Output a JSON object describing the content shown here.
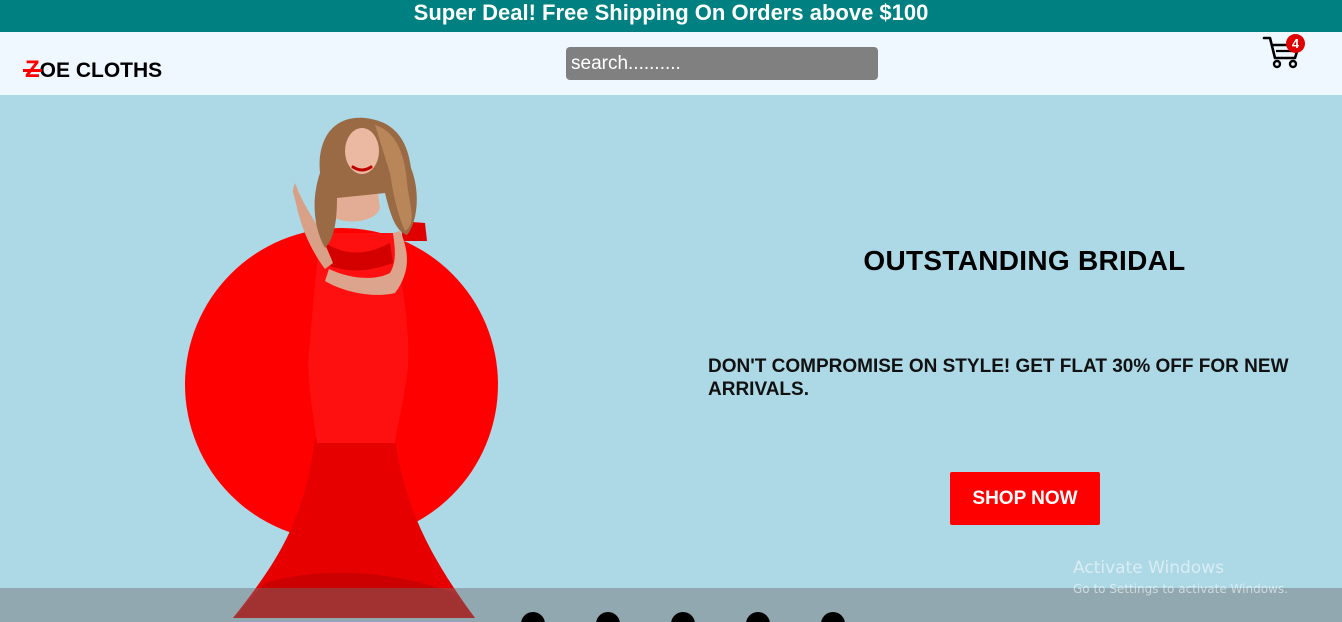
{
  "promo": {
    "text": "Super Deal! Free Shipping On Orders above $100"
  },
  "header": {
    "logo": {
      "first_letter": "Z",
      "rest": "OE CLOTHS"
    },
    "search": {
      "placeholder": "search.........."
    },
    "cart": {
      "icon": "cart-icon",
      "count": "4"
    }
  },
  "hero": {
    "title": "OUTSTANDING BRIDAL",
    "subtitle": "DON'T COMPROMISE ON STYLE! GET FLAT 30% OFF FOR NEW ARRIVALS.",
    "button_label": "SHOP NOW",
    "image_alt": "model in red gown"
  },
  "slider": {
    "dots": 5,
    "active_index": 0
  },
  "watermark": {
    "title": "Activate Windows",
    "subtitle": "Go to Settings to activate Windows."
  },
  "colors": {
    "promo_bg": "#008080",
    "header_bg": "#f0f8ff",
    "hero_bg": "#add8e6",
    "accent": "#ff0000",
    "search_bg": "#808080"
  }
}
